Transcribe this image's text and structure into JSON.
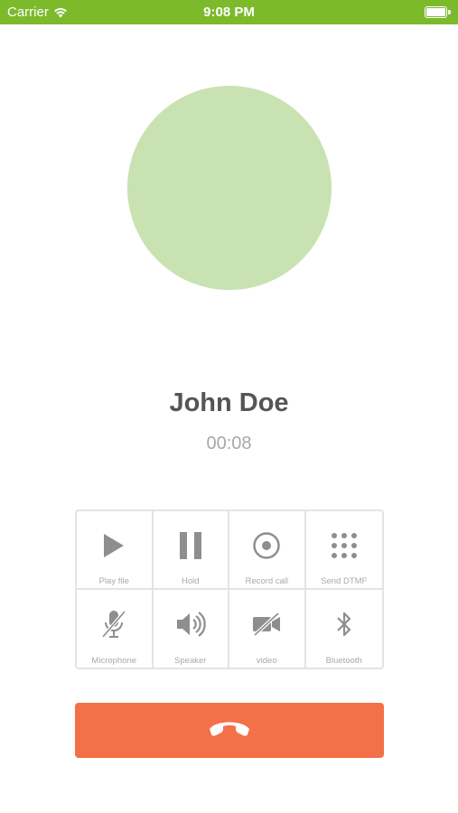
{
  "status_bar": {
    "carrier": "Carrier",
    "time": "9:08 PM",
    "battery_level": 1.0,
    "background_color": "#7cba2c"
  },
  "call": {
    "contact_name": "John Doe",
    "duration": "00:08",
    "avatar_color": "#c8e2b1"
  },
  "controls": [
    {
      "label": "Play file",
      "icon": "play-icon"
    },
    {
      "label": "Hold",
      "icon": "pause-icon"
    },
    {
      "label": "Record call",
      "icon": "record-icon"
    },
    {
      "label": "Send DTMF",
      "icon": "keypad-icon"
    },
    {
      "label": "Microphone",
      "icon": "microphone-muted-icon"
    },
    {
      "label": "Speaker",
      "icon": "speaker-icon"
    },
    {
      "label": "video",
      "icon": "video-off-icon"
    },
    {
      "label": "Bluetooth",
      "icon": "bluetooth-icon"
    }
  ],
  "hangup": {
    "icon": "phone-hangup-icon",
    "color": "#f47048"
  }
}
